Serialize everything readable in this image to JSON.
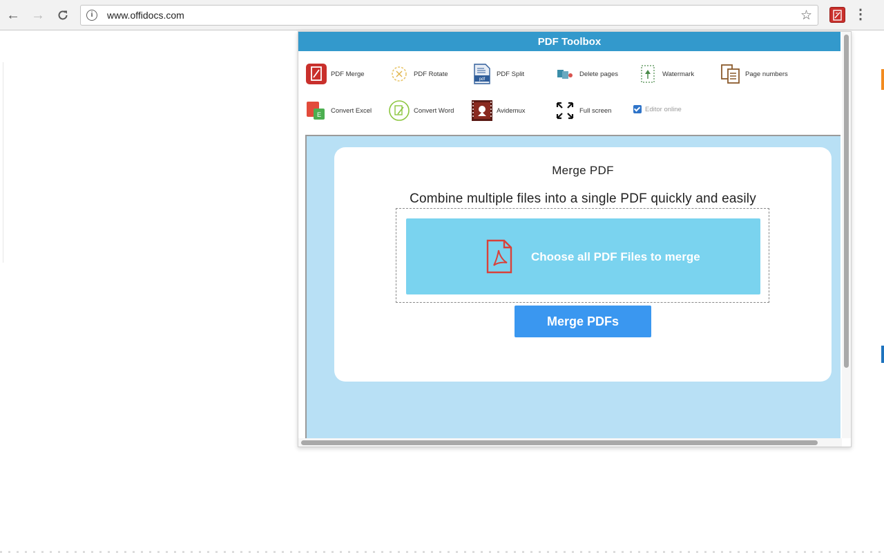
{
  "browser": {
    "url": "www.offidocs.com"
  },
  "popup": {
    "title": "PDF Toolbox",
    "tools": [
      {
        "label": "PDF Merge",
        "icon": "pdf-merge-icon"
      },
      {
        "label": "PDF Rotate",
        "icon": "pdf-rotate-icon"
      },
      {
        "label": "PDF Split",
        "icon": "pdf-split-icon"
      },
      {
        "label": "Delete pages",
        "icon": "delete-pages-icon"
      },
      {
        "label": "Watermark",
        "icon": "watermark-icon"
      },
      {
        "label": "Page numbers",
        "icon": "page-numbers-icon"
      },
      {
        "label": "Convert Excel",
        "icon": "convert-excel-icon"
      },
      {
        "label": "Convert Word",
        "icon": "convert-word-icon"
      },
      {
        "label": "Avidemux",
        "icon": "avidemux-icon"
      },
      {
        "label": "Full screen",
        "icon": "fullscreen-icon"
      }
    ],
    "editor_online": {
      "label": "Editor online",
      "checked": true
    },
    "card": {
      "title": "Merge PDF",
      "subtitle": "Combine multiple files into a single PDF quickly and easily",
      "choose_label": "Choose all PDF Files to merge",
      "merge_label": "Merge PDFs"
    }
  },
  "colors": {
    "header": "#3399cc",
    "content_bg": "#b8e0f5",
    "choose_button": "#7ad3ef",
    "merge_button": "#3a97f0"
  }
}
